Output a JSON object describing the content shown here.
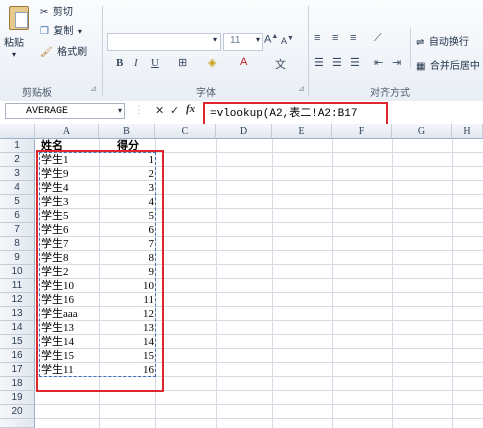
{
  "ribbon": {
    "clipboard": {
      "paste_label": "粘贴",
      "cut_label": "剪切",
      "copy_label": "复制",
      "format_painter_label": "格式刷",
      "group_label": "剪贴板"
    },
    "font": {
      "size_value": "11",
      "bold_label": "B",
      "italic_label": "I",
      "underline_label": "U",
      "group_label": "字体"
    },
    "alignment": {
      "wrap_label": "自动换行",
      "merge_label": "合并后居中",
      "group_label": "对齐方式"
    }
  },
  "formula_bar": {
    "name_box": "AVERAGE",
    "cancel_label": "✕",
    "enter_label": "✓",
    "fx_label": "fx",
    "formula": "=vlookup(A2,表二!A2:B17"
  },
  "columns": [
    "A",
    "B",
    "C",
    "D",
    "E",
    "F",
    "G",
    "H"
  ],
  "rows": [
    "1",
    "2",
    "3",
    "4",
    "5",
    "6",
    "7",
    "8",
    "9",
    "10",
    "11",
    "12",
    "13",
    "14",
    "15",
    "16",
    "17",
    "18",
    "19",
    "20"
  ],
  "header": {
    "name": "姓名",
    "score": "得分"
  },
  "table": [
    {
      "name": "学生1",
      "score": "1"
    },
    {
      "name": "学生9",
      "score": "2"
    },
    {
      "name": "学生4",
      "score": "3"
    },
    {
      "name": "学生3",
      "score": "4"
    },
    {
      "name": "学生5",
      "score": "5"
    },
    {
      "name": "学生6",
      "score": "6"
    },
    {
      "name": "学生7",
      "score": "7"
    },
    {
      "name": "学生8",
      "score": "8"
    },
    {
      "name": "学生2",
      "score": "9"
    },
    {
      "name": "学生10",
      "score": "10"
    },
    {
      "name": "学生16",
      "score": "11"
    },
    {
      "name": "学生aaa",
      "score": "12"
    },
    {
      "name": "学生13",
      "score": "13"
    },
    {
      "name": "学生14",
      "score": "14"
    },
    {
      "name": "学生15",
      "score": "15"
    },
    {
      "name": "学生11",
      "score": "16"
    }
  ],
  "colors": {
    "highlight": "#e0262d",
    "copy_border": "#3f6fb5"
  }
}
